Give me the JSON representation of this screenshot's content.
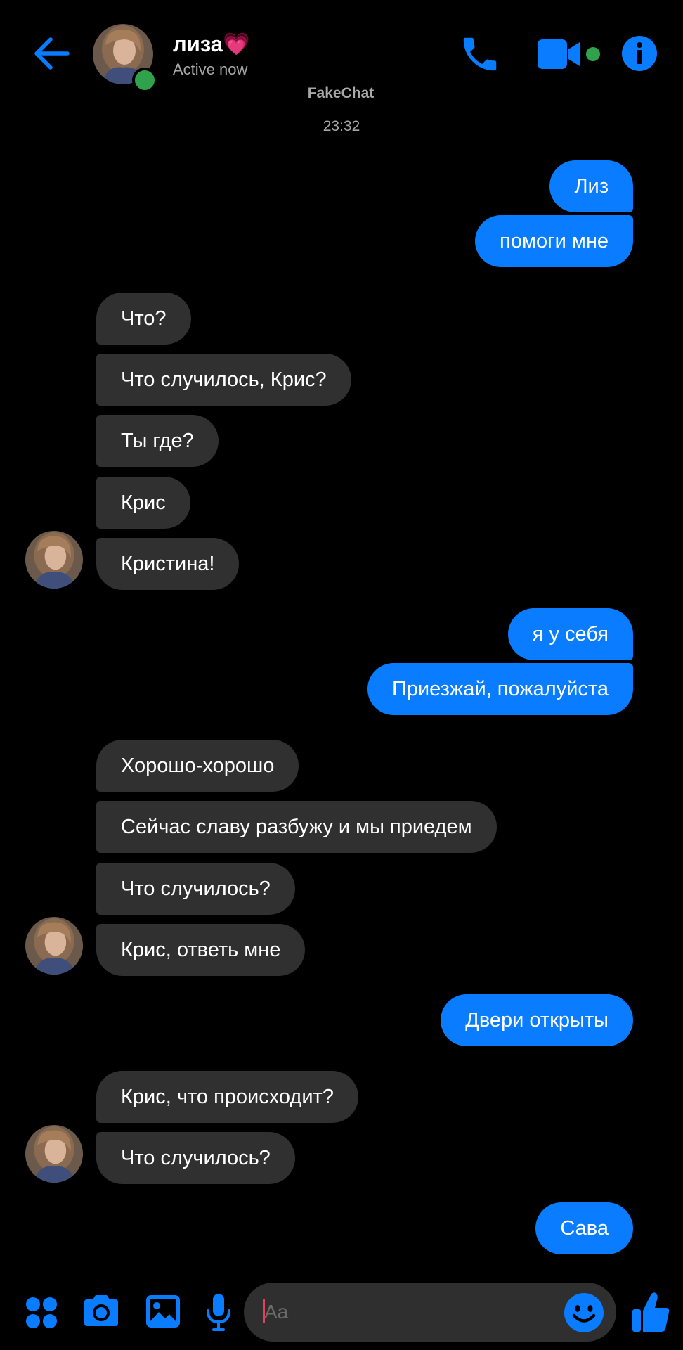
{
  "header": {
    "contact_name": "лиза💗",
    "status": "Active now",
    "app_name": "FakeChat",
    "timestamp": "23:32"
  },
  "colors": {
    "accent": "#0a7cff",
    "incoming_bubble": "#303030",
    "online": "#31a24c",
    "background": "#000000"
  },
  "messages": [
    {
      "side": "out",
      "text": "Лиз"
    },
    {
      "side": "out",
      "text": "помоги мне"
    },
    {
      "side": "in",
      "text": "Что?"
    },
    {
      "side": "in",
      "text": "Что случилось, Крис?"
    },
    {
      "side": "in",
      "text": "Ты где?"
    },
    {
      "side": "in",
      "text": "Крис"
    },
    {
      "side": "in",
      "text": "Кристина!"
    },
    {
      "side": "out",
      "text": "я у себя"
    },
    {
      "side": "out",
      "text": "Приезжай, пожалуйста"
    },
    {
      "side": "in",
      "text": "Хорошо-хорошо"
    },
    {
      "side": "in",
      "text": "Сейчас славу разбужу и мы приедем"
    },
    {
      "side": "in",
      "text": "Что случилось?"
    },
    {
      "side": "in",
      "text": "Крис, ответь  мне"
    },
    {
      "side": "out",
      "text": "Двери открыты"
    },
    {
      "side": "in",
      "text": "Крис, что происходит?"
    },
    {
      "side": "in",
      "text": "Что случилось?"
    },
    {
      "side": "out",
      "text": "Сава"
    }
  ],
  "composer": {
    "placeholder": "Aa"
  },
  "icons": {
    "back": "arrow-left-icon",
    "call": "phone-icon",
    "video": "video-camera-icon",
    "info": "info-icon",
    "apps": "four-dots-icon",
    "camera": "camera-icon",
    "gallery": "image-icon",
    "mic": "microphone-icon",
    "emoji": "smiley-icon",
    "like": "thumbs-up-icon"
  }
}
